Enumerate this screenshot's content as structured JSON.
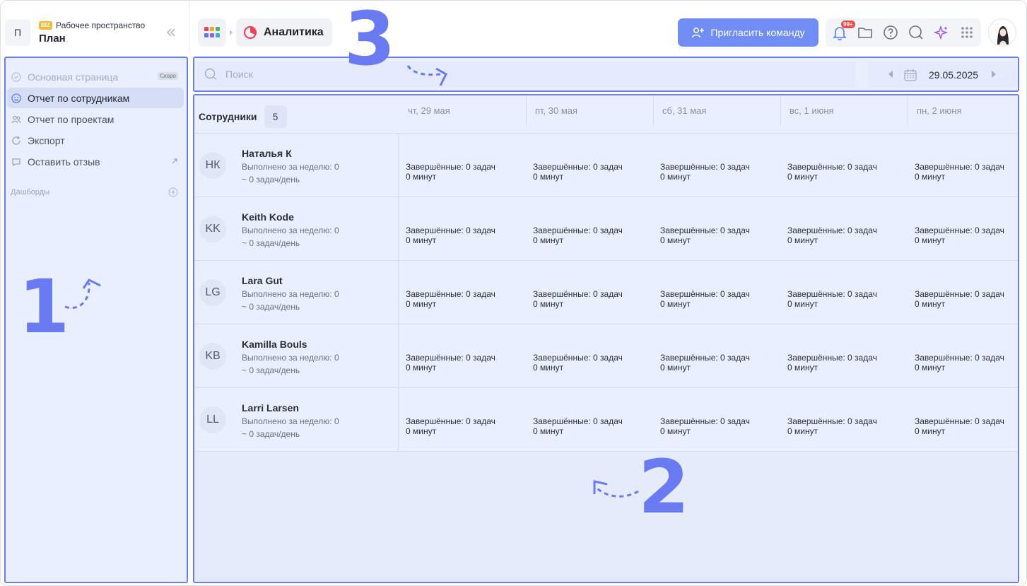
{
  "workspace": {
    "avatar_letter": "П",
    "badge": "BIZ",
    "subtitle": "Рабочее пространство",
    "title": "План"
  },
  "breadcrumb": {
    "section_label": "Аналитика"
  },
  "header": {
    "invite_label": "Пригласить команду",
    "notifications_badge": "99+"
  },
  "sidebar": {
    "items": [
      {
        "label": "Основная страница",
        "tag": "Скоро",
        "icon": "check-circle-icon",
        "state": "disabled"
      },
      {
        "label": "Отчет по сотрудникам",
        "icon": "smile-icon",
        "state": "active"
      },
      {
        "label": "Отчет по проектам",
        "icon": "users-icon",
        "state": "normal"
      },
      {
        "label": "Экспорт",
        "icon": "refresh-icon",
        "state": "normal"
      },
      {
        "label": "Оставить отзыв",
        "icon": "chat-icon",
        "state": "normal"
      }
    ],
    "dashboards_heading": "Дашборды"
  },
  "annotations": {
    "one": "1",
    "two": "2",
    "three": "3"
  },
  "search": {
    "placeholder": "Поиск"
  },
  "date_nav": {
    "date": "29.05.2025"
  },
  "table": {
    "employees_heading": "Сотрудники",
    "employees_count": "5",
    "days": [
      "чт, 29 мая",
      "пт, 30 мая",
      "сб, 31 мая",
      "вс, 1 июня",
      "пн, 2 июня"
    ],
    "rows": [
      {
        "initials": "НК",
        "name": "Наталья К",
        "week": "Выполнено за неделю: 0",
        "avg": "~ 0 задач/день",
        "cells": [
          {
            "done": "Завершённые: 0 задач",
            "time": "0 минут"
          },
          {
            "done": "Завершённые: 0 задач",
            "time": "0 минут"
          },
          {
            "done": "Завершённые: 0 задач",
            "time": "0 минут"
          },
          {
            "done": "Завершённые: 0 задач",
            "time": "0 минут"
          },
          {
            "done": "Завершённые: 0 задач",
            "time": "0 минут"
          }
        ]
      },
      {
        "initials": "KK",
        "name": "Keith Kode",
        "week": "Выполнено за неделю: 0",
        "avg": "~ 0 задач/день",
        "cells": [
          {
            "done": "Завершённые: 0 задач",
            "time": "0 минут"
          },
          {
            "done": "Завершённые: 0 задач",
            "time": "0 минут"
          },
          {
            "done": "Завершённые: 0 задач",
            "time": "0 минут"
          },
          {
            "done": "Завершённые: 0 задач",
            "time": "0 минут"
          },
          {
            "done": "Завершённые: 0 задач",
            "time": "0 минут"
          }
        ]
      },
      {
        "initials": "LG",
        "name": "Lara Gut",
        "week": "Выполнено за неделю: 0",
        "avg": "~ 0 задач/день",
        "cells": [
          {
            "done": "Завершённые: 0 задач",
            "time": "0 минут"
          },
          {
            "done": "Завершённые: 0 задач",
            "time": "0 минут"
          },
          {
            "done": "Завершённые: 0 задач",
            "time": "0 минут"
          },
          {
            "done": "Завершённые: 0 задач",
            "time": "0 минут"
          },
          {
            "done": "Завершённые: 0 задач",
            "time": "0 минут"
          }
        ]
      },
      {
        "initials": "KB",
        "name": "Kamilla Bouls",
        "week": "Выполнено за неделю: 0",
        "avg": "~ 0 задач/день",
        "cells": [
          {
            "done": "Завершённые: 0 задач",
            "time": "0 минут"
          },
          {
            "done": "Завершённые: 0 задач",
            "time": "0 минут"
          },
          {
            "done": "Завершённые: 0 задач",
            "time": "0 минут"
          },
          {
            "done": "Завершённые: 0 задач",
            "time": "0 минут"
          },
          {
            "done": "Завершённые: 0 задач",
            "time": "0 минут"
          }
        ]
      },
      {
        "initials": "LL",
        "name": "Larri Larsen",
        "week": "Выполнено за неделю: 0",
        "avg": "~ 0 задач/день",
        "cells": [
          {
            "done": "Завершённые: 0 задач",
            "time": "0 минут"
          },
          {
            "done": "Завершённые: 0 задач",
            "time": "0 минут"
          },
          {
            "done": "Завершённые: 0 задач",
            "time": "0 минут"
          },
          {
            "done": "Завершённые: 0 задач",
            "time": "0 минут"
          },
          {
            "done": "Завершённые: 0 задач",
            "time": "0 минут"
          }
        ]
      }
    ]
  },
  "colors": {
    "accent": "#6f8df5",
    "annotation": "#6a7af0",
    "notification": "#ee4d4d",
    "analytics_icon": "#e8475b"
  }
}
